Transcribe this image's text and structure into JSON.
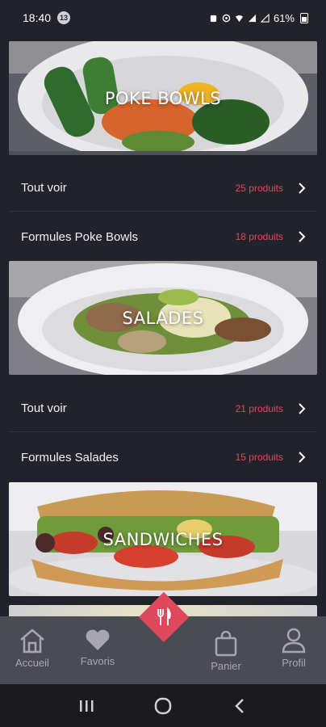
{
  "status_bar": {
    "time": "18:40",
    "notification_count": "13",
    "battery": "61%"
  },
  "categories": [
    {
      "title": "POKE BOWLS",
      "rows": [
        {
          "label": "Tout voir",
          "count": "25 produits"
        },
        {
          "label": "Formules Poke Bowls",
          "count": "18 produits"
        }
      ]
    },
    {
      "title": "SALADES",
      "rows": [
        {
          "label": "Tout voir",
          "count": "21 produits"
        },
        {
          "label": "Formules Salades",
          "count": "15 produits"
        }
      ]
    },
    {
      "title": "SANDWICHES",
      "rows": []
    }
  ],
  "bottom_nav": {
    "home": "Accueil",
    "favorites": "Favoris",
    "cart": "Panier",
    "profile": "Profil"
  },
  "colors": {
    "background": "#22222b",
    "accent": "#e0485d",
    "nav_bar": "#4b4b52",
    "nav_text": "#a7a7ad"
  },
  "icons": {
    "center_fab": "fork-knife-icon",
    "home": "home-icon",
    "favorites": "heart-icon",
    "cart": "shopping-bag-icon",
    "profile": "user-icon"
  }
}
